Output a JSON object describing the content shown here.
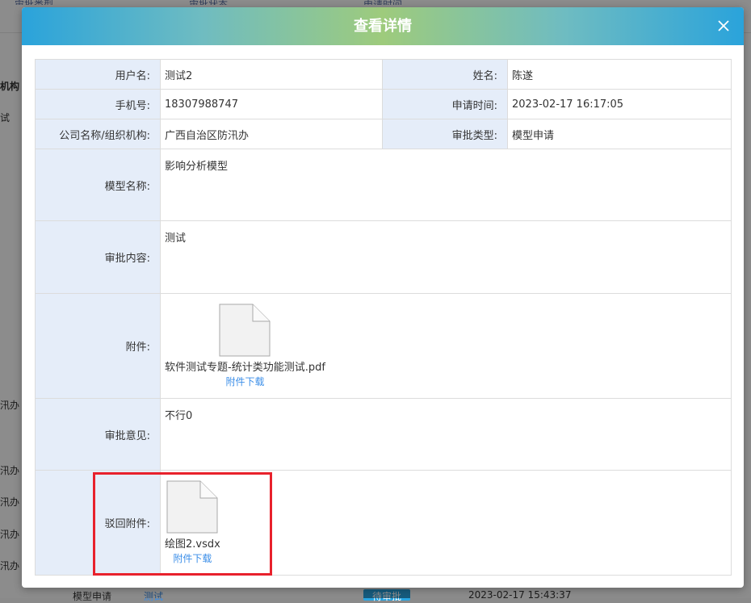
{
  "background": {
    "headers": [
      "审批类型",
      "审批状态",
      "申请时间"
    ],
    "left_labels": [
      "机构",
      "试",
      "汛办",
      "汛办",
      "汛办",
      "汛办",
      "汛办"
    ],
    "bottom_row": {
      "type": "模型申请",
      "name": "测试",
      "status": "待审批",
      "time": "2023-02-17 15:43:37"
    }
  },
  "modal": {
    "title": "查看详情",
    "close_label": "×",
    "fields": {
      "username_label": "用户名:",
      "username": "测试2",
      "name_label": "姓名:",
      "name": "陈遂",
      "phone_label": "手机号:",
      "phone": "18307988747",
      "apply_time_label": "申请时间:",
      "apply_time": "2023-02-17 16:17:05",
      "company_label": "公司名称/组织机构:",
      "company": "广西自治区防汛办",
      "approval_type_label": "审批类型:",
      "approval_type": "模型申请",
      "model_name_label": "模型名称:",
      "model_name": "影响分析模型",
      "approval_content_label": "审批内容:",
      "approval_content": "测试",
      "attachment_label": "附件:",
      "attachment_file": "软件测试专题-统计类功能测试.pdf",
      "attachment_download": "附件下载",
      "approval_opinion_label": "审批意见:",
      "approval_opinion": "不行0",
      "reject_attachment_label": "驳回附件:",
      "reject_attachment_file": "绘图2.vsdx",
      "reject_attachment_download": "附件下载"
    }
  },
  "colors": {
    "label_bg": "#e5edf9",
    "link": "#3b8ee8",
    "highlight": "#e8212c",
    "header_start": "#2aa3db",
    "header_mid": "#9ecb7c"
  }
}
